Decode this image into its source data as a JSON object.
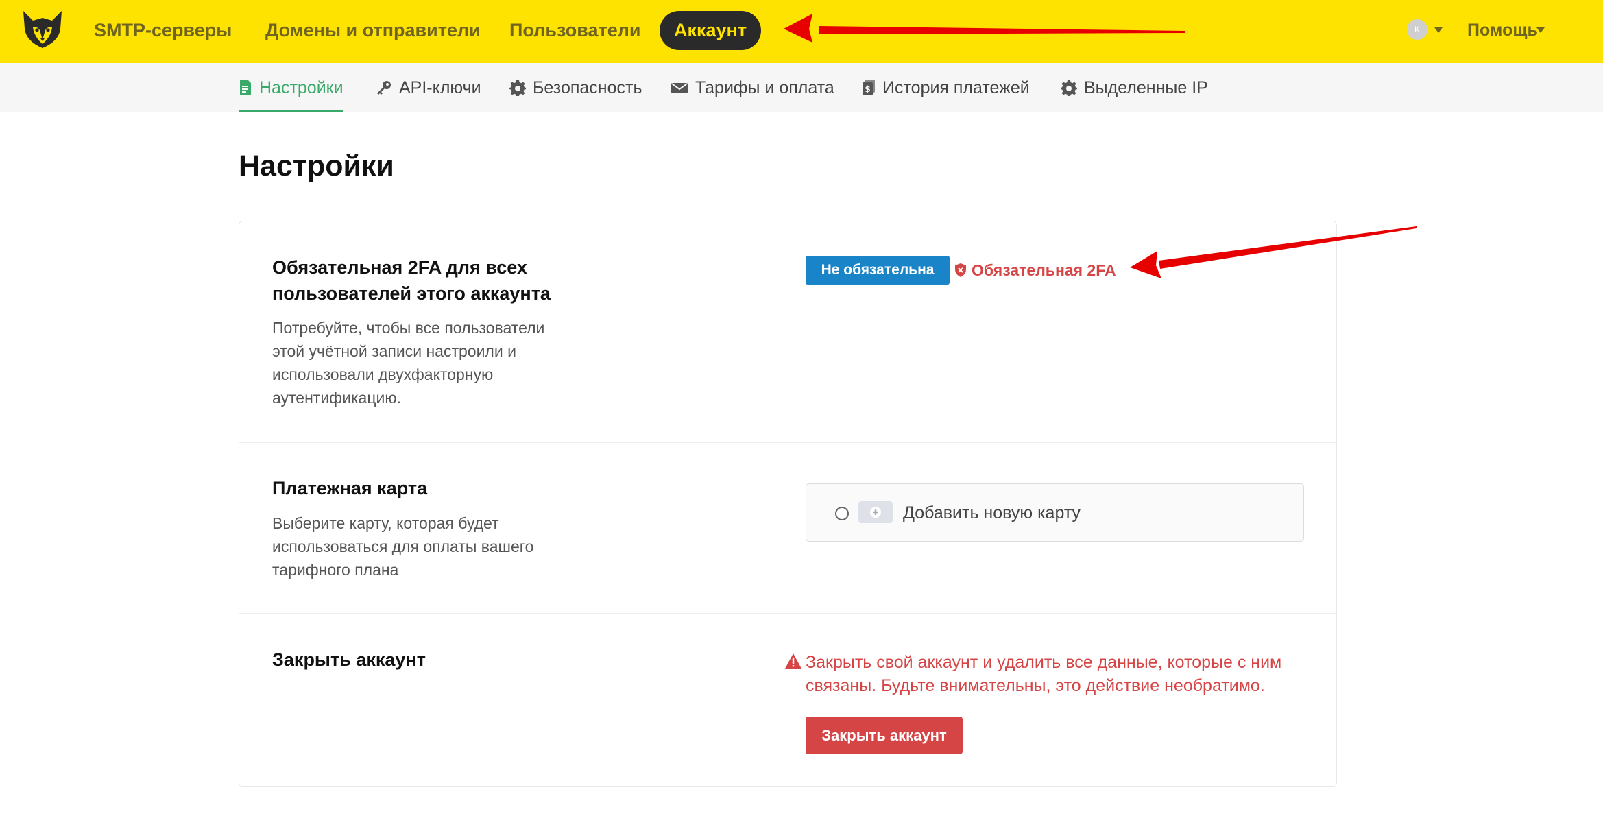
{
  "nav": {
    "items": [
      "SMTP-серверы",
      "Домены и отправители",
      "Пользователи"
    ],
    "active": "Аккаунт",
    "avatar_initial": "K",
    "help": "Помощь"
  },
  "subnav": {
    "items": [
      "Настройки",
      "API-ключи",
      "Безопасность",
      "Тарифы и оплата",
      "История платежей",
      "Выделенные IP"
    ],
    "active_index": 0
  },
  "page": {
    "title": "Настройки"
  },
  "twofa": {
    "title": "Обязательная 2FA для всех пользователей этого аккаунта",
    "description": "Потребуйте, чтобы все пользователи этой учётной записи настроили и использовали двухфакторную аутентификацию.",
    "status_button": "Не обязательна",
    "require_link": "Обязательная 2FA"
  },
  "payment": {
    "title": "Платежная карта",
    "description": "Выберите карту, которая будет использоваться для оплаты вашего тарифного плана",
    "add_card": "Добавить новую карту"
  },
  "close_account": {
    "title": "Закрыть аккаунт",
    "warning": "Закрыть свой аккаунт и удалить все данные, которые с ним связаны. Будьте внимательны, это действие необратимо.",
    "button": "Закрыть аккаунт"
  },
  "colors": {
    "topbar": "#ffe300",
    "active_tab": "#3aaa6a",
    "primary": "#1a84c8",
    "danger": "#d64545",
    "annotation_arrow": "#e60000"
  }
}
